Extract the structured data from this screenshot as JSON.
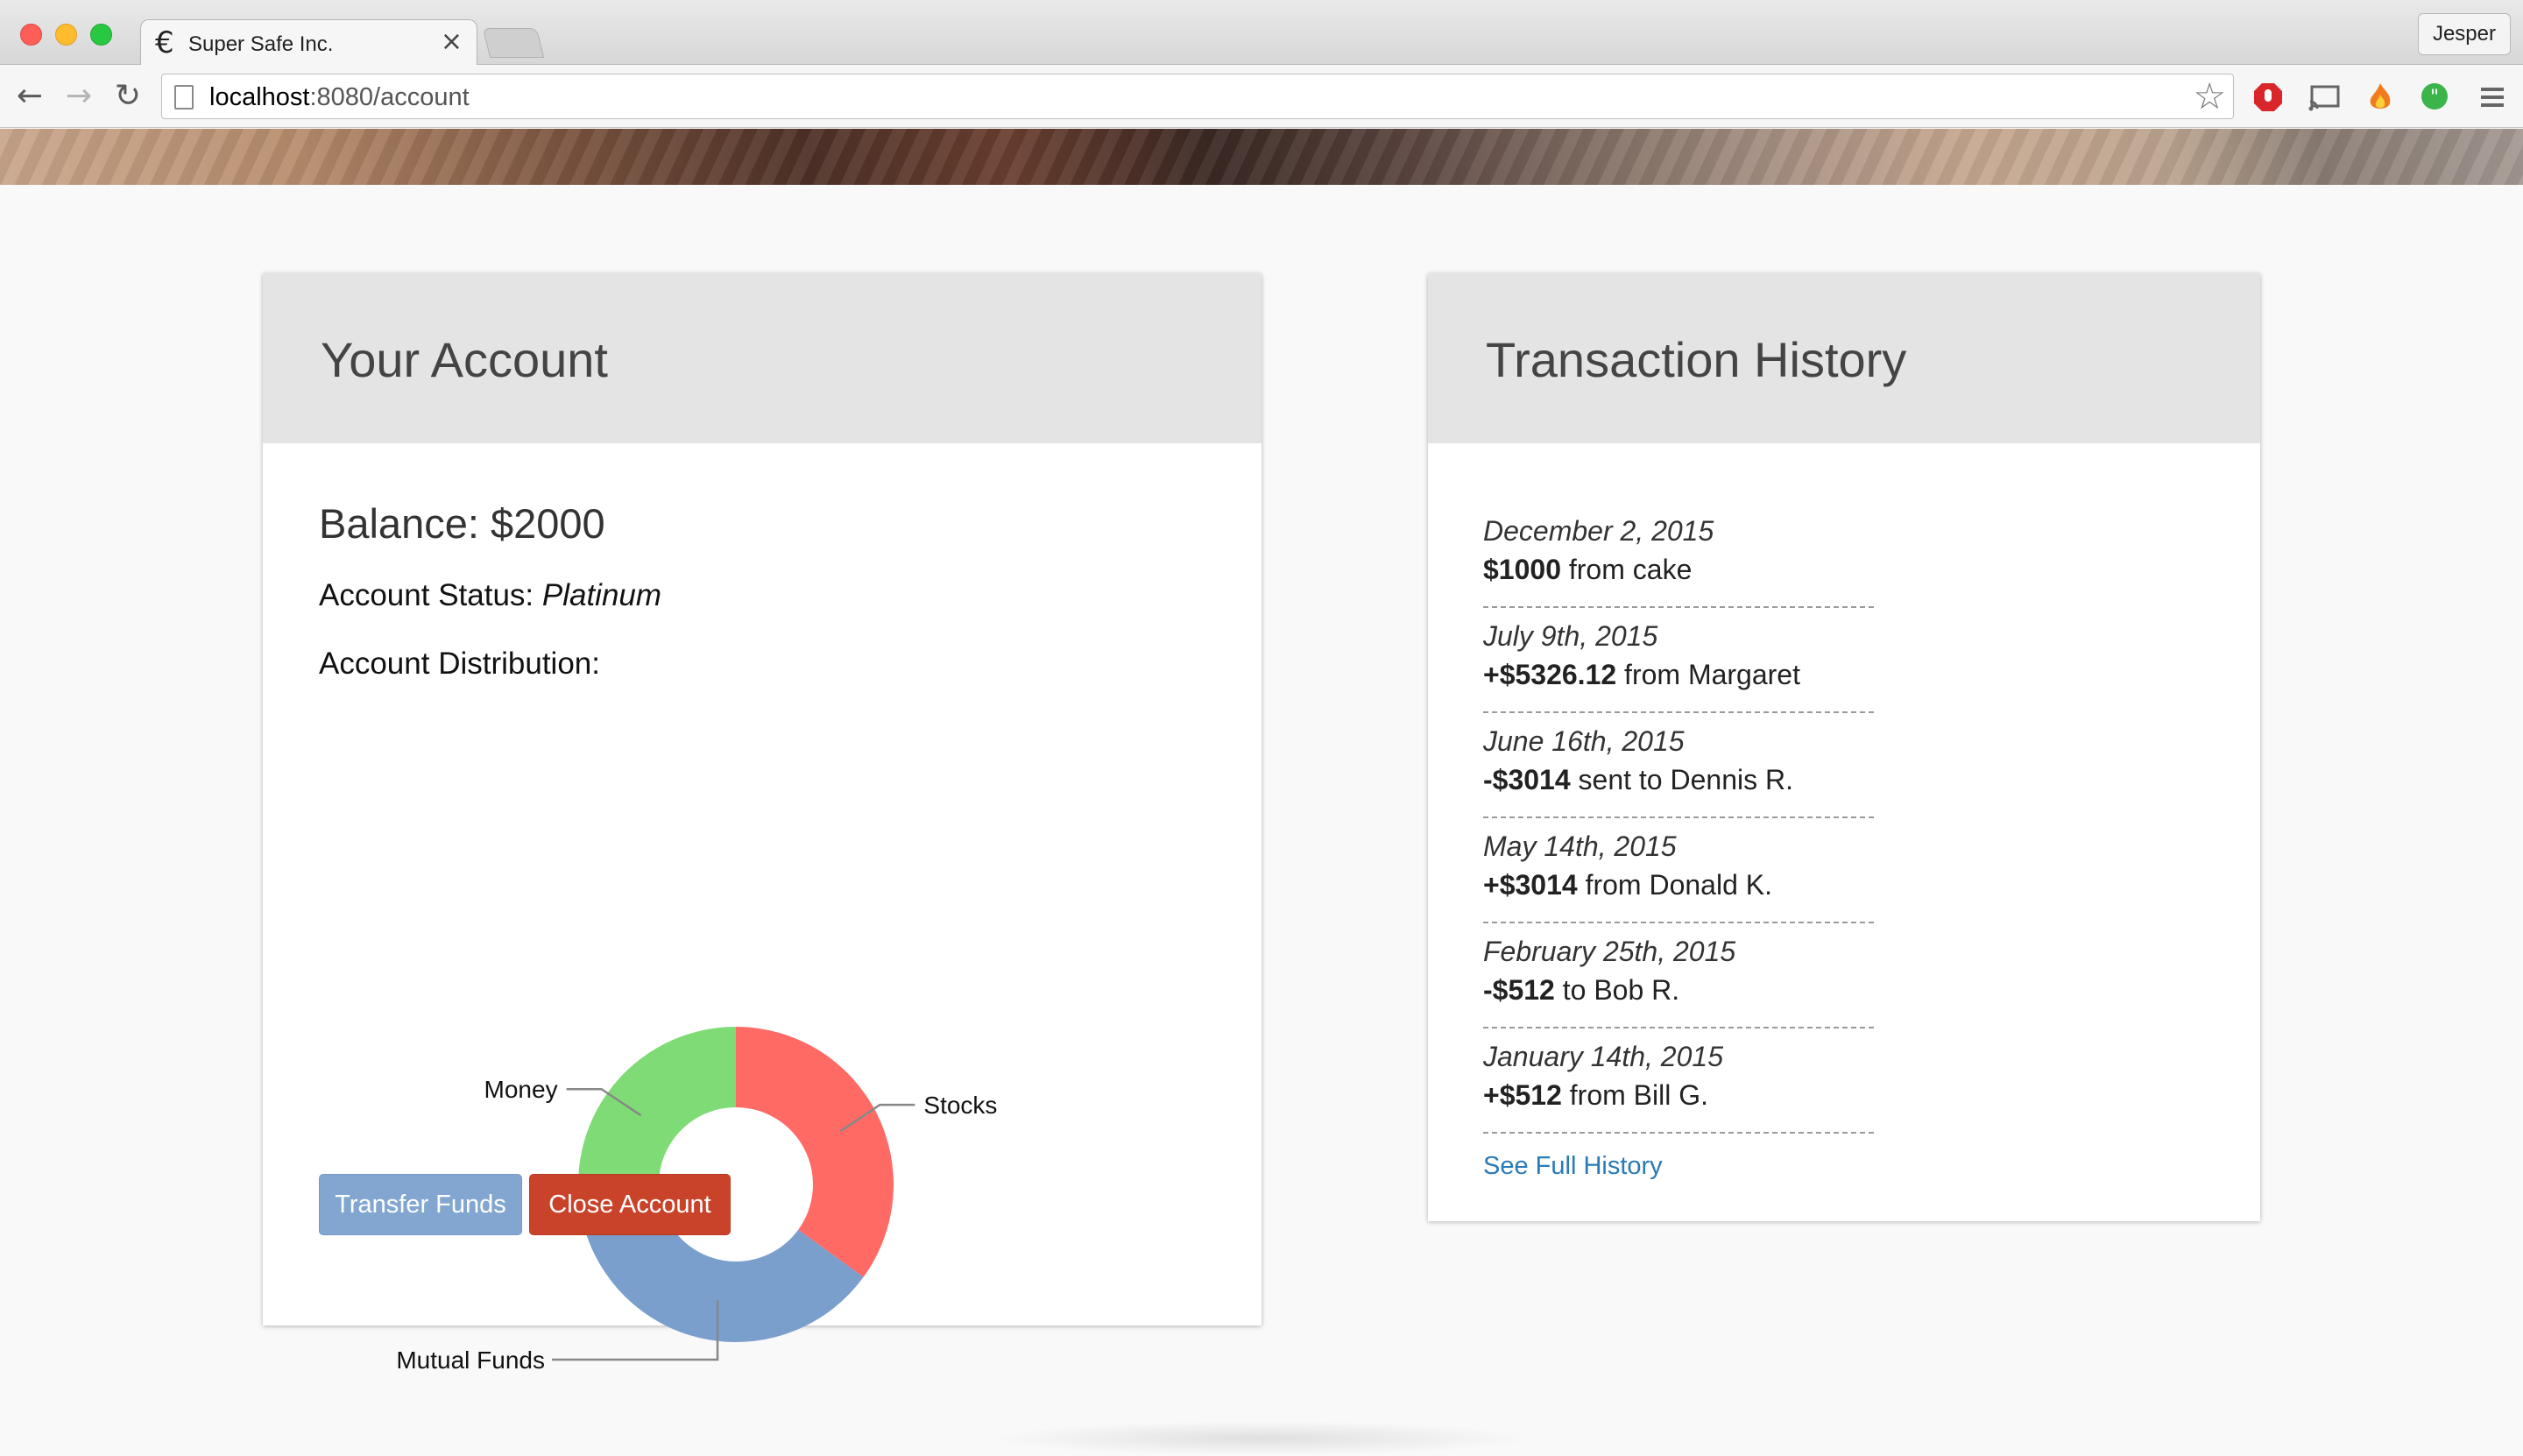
{
  "browser": {
    "tab_title": "Super Safe Inc.",
    "tab_icon": "euro-icon",
    "profile_name": "Jesper",
    "url_host": "localhost",
    "url_path": ":8080/account"
  },
  "account": {
    "title": "Your Account",
    "balance": "Balance: $2000",
    "status_label": "Account Status: ",
    "status_value": "Platinum",
    "distribution_label": "Account Distribution:",
    "transfer_button": "Transfer Funds",
    "close_button": "Close Account"
  },
  "chart_data": {
    "type": "pie",
    "donut": true,
    "categories": [
      "Stocks",
      "Mutual Funds",
      "Money"
    ],
    "values": [
      35,
      35,
      30
    ],
    "colors": [
      "#ff6a65",
      "#7a9fcc",
      "#7edb76"
    ],
    "title": "",
    "legend": "none"
  },
  "history": {
    "title": "Transaction History",
    "transactions": [
      {
        "date": "December 2, 2015",
        "amount": "$1000",
        "text": " from cake"
      },
      {
        "date": "July 9th, 2015",
        "amount": "+$5326.12",
        "text": " from Margaret"
      },
      {
        "date": "June 16th, 2015",
        "amount": "-$3014",
        "text": " sent to Dennis R."
      },
      {
        "date": "May 14th, 2015",
        "amount": "+$3014",
        "text": " from Donald K."
      },
      {
        "date": "February 25th, 2015",
        "amount": "-$512",
        "text": " to Bob R."
      },
      {
        "date": "January 14th, 2015",
        "amount": "+$512",
        "text": " from Bill G."
      }
    ],
    "full_history_link": "See Full History"
  }
}
